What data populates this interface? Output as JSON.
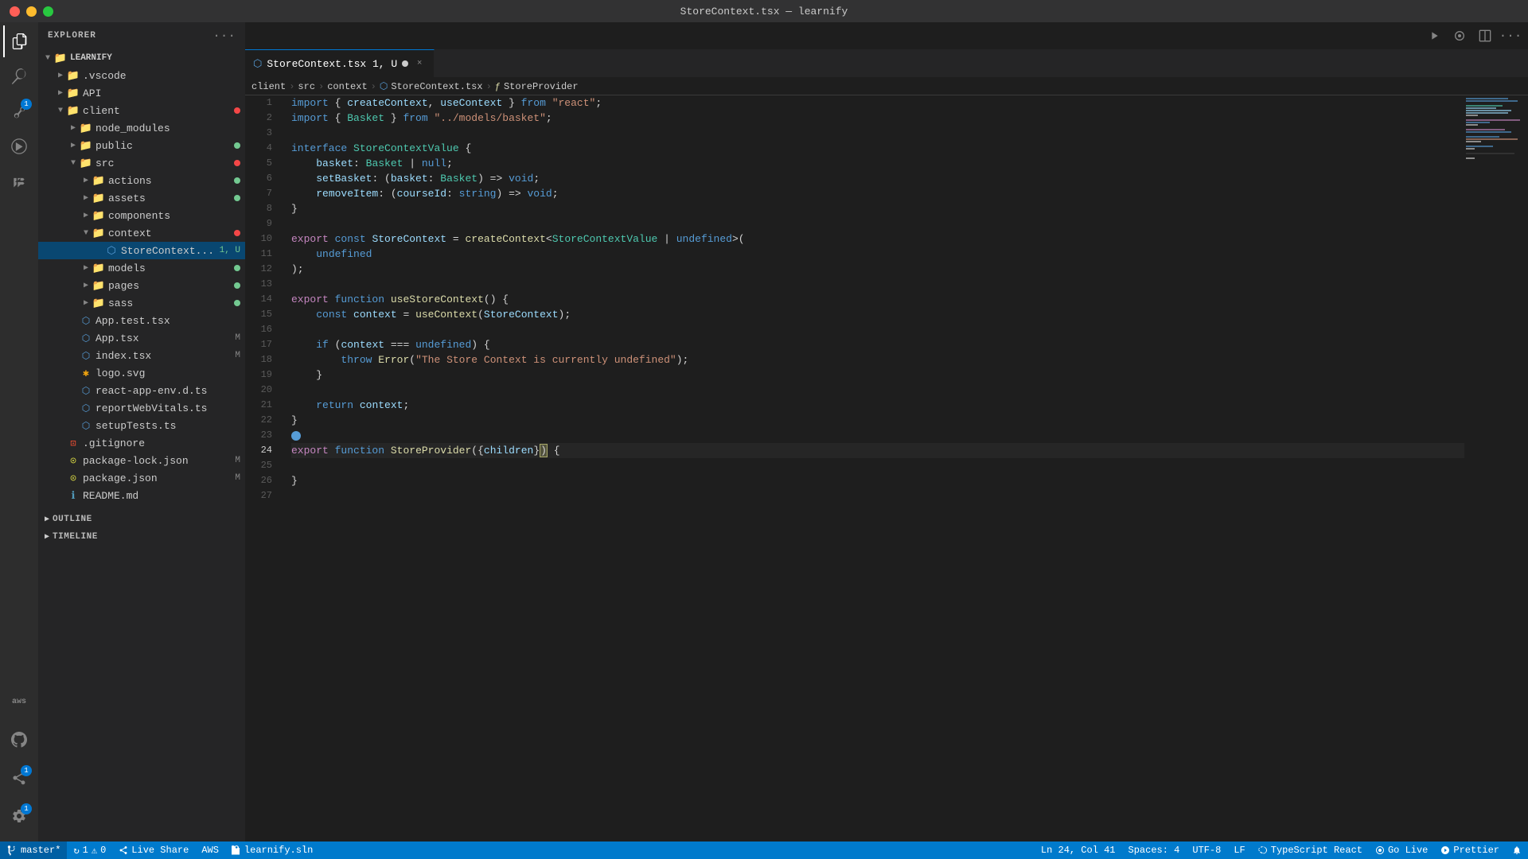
{
  "window": {
    "title": "StoreContext.tsx — learnify"
  },
  "titlebar": {
    "buttons": {
      "close": "close",
      "minimize": "minimize",
      "maximize": "maximize"
    }
  },
  "activity_bar": {
    "icons": [
      {
        "name": "explorer",
        "symbol": "⎘",
        "active": true,
        "badge": null
      },
      {
        "name": "search",
        "symbol": "🔍",
        "active": false,
        "badge": null
      },
      {
        "name": "source-control",
        "symbol": "⎇",
        "active": false,
        "badge": "1"
      },
      {
        "name": "run",
        "symbol": "▷",
        "active": false,
        "badge": null
      },
      {
        "name": "extensions",
        "symbol": "⊞",
        "active": false,
        "badge": null
      }
    ],
    "bottom_icons": [
      {
        "name": "aws",
        "label": "aws"
      },
      {
        "name": "github",
        "symbol": "⊙"
      },
      {
        "name": "live-share",
        "symbol": "↔",
        "badge": "1"
      },
      {
        "name": "settings",
        "symbol": "⚙",
        "badge": "1"
      }
    ]
  },
  "sidebar": {
    "title": "EXPLORER",
    "more_icon": "···",
    "tree": {
      "root": {
        "label": "LEARNIFY",
        "expanded": true,
        "items": [
          {
            "label": ".vscode",
            "type": "folder",
            "expanded": false,
            "indent": 1,
            "badge": null
          },
          {
            "label": "API",
            "type": "folder",
            "expanded": false,
            "indent": 1,
            "badge": null
          },
          {
            "label": "client",
            "type": "folder-special",
            "expanded": true,
            "indent": 1,
            "badge": "red"
          },
          {
            "label": "node_modules",
            "type": "folder-special",
            "expanded": false,
            "indent": 2,
            "badge": null
          },
          {
            "label": "public",
            "type": "folder-special",
            "expanded": false,
            "indent": 2,
            "badge": "green"
          },
          {
            "label": "src",
            "type": "folder-special",
            "expanded": true,
            "indent": 2,
            "badge": "red"
          },
          {
            "label": "actions",
            "type": "folder-special",
            "expanded": false,
            "indent": 3,
            "badge": "green"
          },
          {
            "label": "assets",
            "type": "folder-special",
            "expanded": false,
            "indent": 3,
            "badge": "green"
          },
          {
            "label": "components",
            "type": "folder-special",
            "expanded": false,
            "indent": 3,
            "badge": null
          },
          {
            "label": "context",
            "type": "folder-special",
            "expanded": true,
            "indent": 3,
            "badge": "red"
          },
          {
            "label": "StoreContext.tsx",
            "type": "file-ts",
            "indent": 4,
            "badge": null,
            "modified": "1, U",
            "active": true
          },
          {
            "label": "models",
            "type": "folder-special",
            "expanded": false,
            "indent": 3,
            "badge": "green"
          },
          {
            "label": "pages",
            "type": "folder-special",
            "expanded": false,
            "indent": 3,
            "badge": "green"
          },
          {
            "label": "sass",
            "type": "folder-special",
            "expanded": false,
            "indent": 3,
            "badge": "green"
          },
          {
            "label": "App.test.tsx",
            "type": "file-ts",
            "indent": 2,
            "badge": null
          },
          {
            "label": "App.tsx",
            "type": "file-ts",
            "indent": 2,
            "modified": "M",
            "badge": null
          },
          {
            "label": "index.tsx",
            "type": "file-ts",
            "indent": 2,
            "modified": "M",
            "badge": null
          },
          {
            "label": "logo.svg",
            "type": "file-svg",
            "indent": 2,
            "badge": null
          },
          {
            "label": "react-app-env.d.ts",
            "type": "file-ts",
            "indent": 2,
            "badge": null
          },
          {
            "label": "reportWebVitals.ts",
            "type": "file-ts",
            "indent": 2,
            "badge": null
          },
          {
            "label": "setupTests.ts",
            "type": "file-ts",
            "indent": 2,
            "badge": null
          },
          {
            "label": ".gitignore",
            "type": "file-git",
            "indent": 1,
            "badge": null
          },
          {
            "label": "package-lock.json",
            "type": "file-json",
            "indent": 1,
            "modified": "M",
            "badge": null
          },
          {
            "label": "package.json",
            "type": "file-json",
            "indent": 1,
            "modified": "M",
            "badge": null
          },
          {
            "label": "README.md",
            "type": "file-md",
            "indent": 1,
            "badge": null
          }
        ]
      }
    },
    "sections": [
      {
        "label": "OUTLINE",
        "expanded": false
      },
      {
        "label": "TIMELINE",
        "expanded": false
      }
    ]
  },
  "tabs": [
    {
      "label": "StoreContext.tsx",
      "number": "1, U",
      "active": true,
      "icon": "tsx",
      "modified": true
    }
  ],
  "breadcrumb": {
    "items": [
      "client",
      "src",
      "context",
      "StoreContext.tsx",
      "StoreProvider"
    ]
  },
  "toolbar": {
    "run_icon": "▷",
    "debug_icon": "⊙",
    "split_icon": "⊡",
    "more_icon": "···"
  },
  "editor": {
    "filename": "StoreContext.tsx",
    "lines": [
      {
        "num": 1,
        "tokens": [
          {
            "t": "kw",
            "v": "import"
          },
          {
            "t": "plain",
            "v": " { "
          },
          {
            "t": "var",
            "v": "createContext"
          },
          {
            "t": "plain",
            "v": ", "
          },
          {
            "t": "var",
            "v": "useContext"
          },
          {
            "t": "plain",
            "v": " } "
          },
          {
            "t": "kw",
            "v": "from"
          },
          {
            "t": "plain",
            "v": " "
          },
          {
            "t": "str",
            "v": "\"react\""
          },
          {
            "t": "plain",
            "v": ";"
          }
        ]
      },
      {
        "num": 2,
        "tokens": [
          {
            "t": "kw",
            "v": "import"
          },
          {
            "t": "plain",
            "v": " { "
          },
          {
            "t": "type",
            "v": "Basket"
          },
          {
            "t": "plain",
            "v": " } "
          },
          {
            "t": "kw",
            "v": "from"
          },
          {
            "t": "plain",
            "v": " "
          },
          {
            "t": "str",
            "v": "\"../models/basket\""
          },
          {
            "t": "plain",
            "v": ";"
          }
        ]
      },
      {
        "num": 3,
        "tokens": []
      },
      {
        "num": 4,
        "tokens": [
          {
            "t": "kw",
            "v": "interface"
          },
          {
            "t": "plain",
            "v": " "
          },
          {
            "t": "type",
            "v": "StoreContextValue"
          },
          {
            "t": "plain",
            "v": " {"
          }
        ]
      },
      {
        "num": 5,
        "tokens": [
          {
            "t": "plain",
            "v": "    "
          },
          {
            "t": "prop",
            "v": "basket"
          },
          {
            "t": "plain",
            "v": ": "
          },
          {
            "t": "type",
            "v": "Basket"
          },
          {
            "t": "plain",
            "v": " | "
          },
          {
            "t": "kw",
            "v": "null"
          },
          {
            "t": "plain",
            "v": ";"
          }
        ]
      },
      {
        "num": 6,
        "tokens": [
          {
            "t": "plain",
            "v": "    "
          },
          {
            "t": "prop",
            "v": "setBasket"
          },
          {
            "t": "plain",
            "v": ": ("
          },
          {
            "t": "var",
            "v": "basket"
          },
          {
            "t": "plain",
            "v": ": "
          },
          {
            "t": "type",
            "v": "Basket"
          },
          {
            "t": "plain",
            "v": ") => "
          },
          {
            "t": "kw",
            "v": "void"
          },
          {
            "t": "plain",
            "v": ";"
          }
        ]
      },
      {
        "num": 7,
        "tokens": [
          {
            "t": "plain",
            "v": "    "
          },
          {
            "t": "prop",
            "v": "removeItem"
          },
          {
            "t": "plain",
            "v": ": ("
          },
          {
            "t": "var",
            "v": "courseId"
          },
          {
            "t": "plain",
            "v": ": "
          },
          {
            "t": "kw",
            "v": "string"
          },
          {
            "t": "plain",
            "v": ") => "
          },
          {
            "t": "kw",
            "v": "void"
          },
          {
            "t": "plain",
            "v": ";"
          }
        ]
      },
      {
        "num": 8,
        "tokens": [
          {
            "t": "plain",
            "v": "}"
          }
        ]
      },
      {
        "num": 9,
        "tokens": []
      },
      {
        "num": 10,
        "tokens": [
          {
            "t": "kw2",
            "v": "export"
          },
          {
            "t": "plain",
            "v": " "
          },
          {
            "t": "kw",
            "v": "const"
          },
          {
            "t": "plain",
            "v": " "
          },
          {
            "t": "var",
            "v": "StoreContext"
          },
          {
            "t": "plain",
            "v": " = "
          },
          {
            "t": "fn",
            "v": "createContext"
          },
          {
            "t": "plain",
            "v": "<"
          },
          {
            "t": "type",
            "v": "StoreContextValue"
          },
          {
            "t": "plain",
            "v": " | "
          },
          {
            "t": "kw",
            "v": "undefined"
          },
          {
            "t": "plain",
            "v": ">( "
          }
        ]
      },
      {
        "num": 11,
        "tokens": [
          {
            "t": "plain",
            "v": "    "
          },
          {
            "t": "kw",
            "v": "undefined"
          }
        ]
      },
      {
        "num": 12,
        "tokens": [
          {
            "t": "plain",
            "v": "};"
          }
        ]
      },
      {
        "num": 13,
        "tokens": []
      },
      {
        "num": 14,
        "tokens": [
          {
            "t": "kw2",
            "v": "export"
          },
          {
            "t": "plain",
            "v": " "
          },
          {
            "t": "kw",
            "v": "function"
          },
          {
            "t": "plain",
            "v": " "
          },
          {
            "t": "fn",
            "v": "useStoreContext"
          },
          {
            "t": "plain",
            "v": "() {"
          }
        ]
      },
      {
        "num": 15,
        "tokens": [
          {
            "t": "plain",
            "v": "    "
          },
          {
            "t": "kw",
            "v": "const"
          },
          {
            "t": "plain",
            "v": " "
          },
          {
            "t": "var",
            "v": "context"
          },
          {
            "t": "plain",
            "v": " = "
          },
          {
            "t": "fn",
            "v": "useContext"
          },
          {
            "t": "plain",
            "v": "("
          },
          {
            "t": "var",
            "v": "StoreContext"
          },
          {
            "t": "plain",
            "v": ");"
          }
        ]
      },
      {
        "num": 16,
        "tokens": []
      },
      {
        "num": 17,
        "tokens": [
          {
            "t": "plain",
            "v": "    "
          },
          {
            "t": "kw",
            "v": "if"
          },
          {
            "t": "plain",
            "v": " ("
          },
          {
            "t": "var",
            "v": "context"
          },
          {
            "t": "plain",
            "v": " === "
          },
          {
            "t": "kw",
            "v": "undefined"
          },
          {
            "t": "plain",
            "v": ") {"
          }
        ]
      },
      {
        "num": 18,
        "tokens": [
          {
            "t": "plain",
            "v": "        "
          },
          {
            "t": "kw",
            "v": "throw"
          },
          {
            "t": "plain",
            "v": " "
          },
          {
            "t": "fn",
            "v": "Error"
          },
          {
            "t": "plain",
            "v": "("
          },
          {
            "t": "str",
            "v": "\"The Store Context is currently undefined\""
          },
          {
            "t": "plain",
            "v": ");"
          }
        ]
      },
      {
        "num": 19,
        "tokens": [
          {
            "t": "plain",
            "v": "    }"
          }
        ]
      },
      {
        "num": 20,
        "tokens": []
      },
      {
        "num": 21,
        "tokens": [
          {
            "t": "plain",
            "v": "    "
          },
          {
            "t": "kw",
            "v": "return"
          },
          {
            "t": "plain",
            "v": " "
          },
          {
            "t": "var",
            "v": "context"
          },
          {
            "t": "plain",
            "v": ";"
          }
        ]
      },
      {
        "num": 22,
        "tokens": [
          {
            "t": "plain",
            "v": "}"
          }
        ]
      },
      {
        "num": 23,
        "tokens": []
      },
      {
        "num": 24,
        "tokens": [
          {
            "t": "kw2",
            "v": "export"
          },
          {
            "t": "plain",
            "v": " "
          },
          {
            "t": "kw",
            "v": "function"
          },
          {
            "t": "plain",
            "v": " "
          },
          {
            "t": "fn",
            "v": "StoreProvider"
          },
          {
            "t": "plain",
            "v": "({"
          },
          {
            "t": "var",
            "v": "children"
          },
          {
            "t": "plain",
            "v": "}) {"
          }
        ],
        "active": true
      },
      {
        "num": 25,
        "tokens": []
      },
      {
        "num": 26,
        "tokens": [
          {
            "t": "plain",
            "v": "}"
          }
        ]
      },
      {
        "num": 27,
        "tokens": []
      }
    ]
  },
  "statusbar": {
    "branch": "master*",
    "sync_icon": "↻",
    "errors": "1",
    "warnings": "0",
    "live_share": "Live Share",
    "aws": "AWS",
    "workspace": "learnify.sln",
    "cursor_pos": "Ln 24, Col 41",
    "spaces": "Spaces: 4",
    "encoding": "UTF-8",
    "line_ending": "LF",
    "language": "TypeScript React",
    "go_live": "Go Live",
    "prettier": "Prettier",
    "bell_icon": "🔔"
  }
}
